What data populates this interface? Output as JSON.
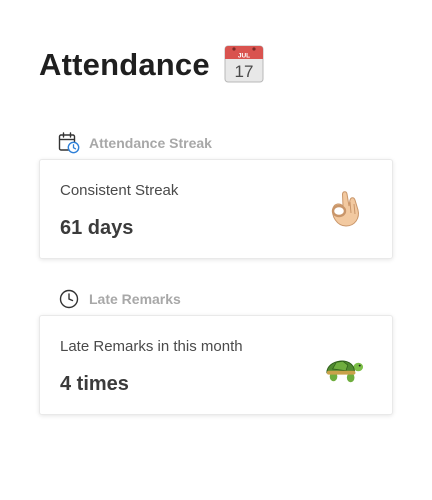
{
  "header": {
    "title": "Attendance",
    "calendar_icon": {
      "name": "calendar-emoji-icon",
      "month": "JUL",
      "day": "17",
      "accent_color": "#d9534f"
    }
  },
  "sections": [
    {
      "label": "Attendance Streak",
      "icon": "calendar-clock-icon",
      "card": {
        "label": "Consistent Streak",
        "value": "61 days",
        "emoji": "ok-hand-emoji-icon"
      }
    },
    {
      "label": "Late Remarks",
      "icon": "clock-icon",
      "card": {
        "label": "Late Remarks in this month",
        "value": "4 times",
        "emoji": "turtle-emoji-icon"
      }
    }
  ],
  "colors": {
    "title": "#1f1f1f",
    "section_label": "#a8a8a8",
    "card_text": "#4a4a4a",
    "icon_blue": "#2f80d8"
  }
}
